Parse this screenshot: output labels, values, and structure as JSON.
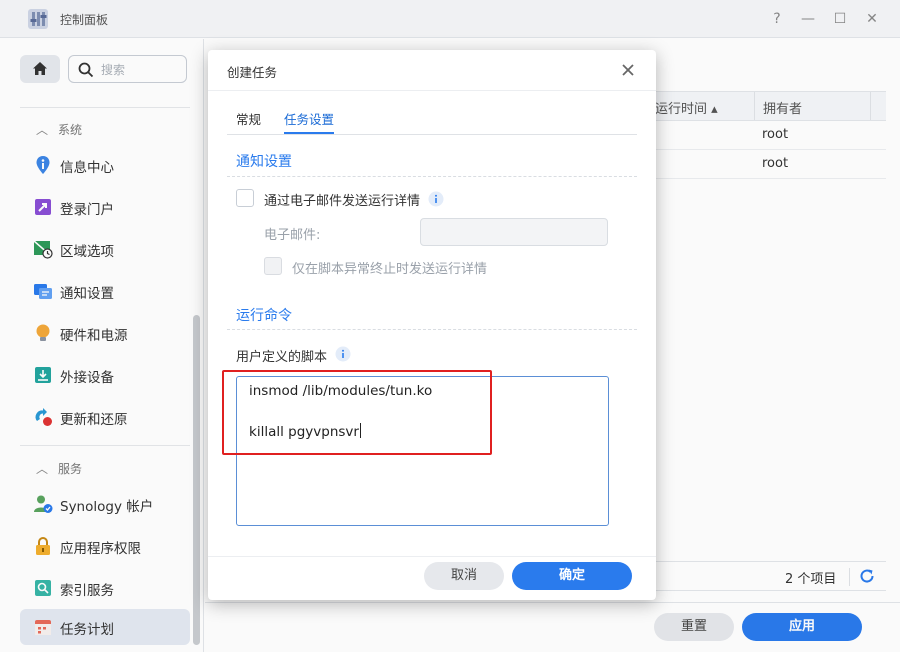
{
  "window": {
    "title": "控制面板",
    "controls": {
      "help": "?",
      "minimize": "—",
      "maximize": "☐",
      "close": "✕"
    }
  },
  "sidebar": {
    "search_placeholder": "搜索",
    "section_system": "系统",
    "section_services": "服务",
    "items": [
      {
        "label": "信息中心",
        "icon": "info-center-icon"
      },
      {
        "label": "登录门户",
        "icon": "login-portal-icon"
      },
      {
        "label": "区域选项",
        "icon": "regional-options-icon"
      },
      {
        "label": "通知设置",
        "icon": "notification-icon"
      },
      {
        "label": "硬件和电源",
        "icon": "hardware-power-icon"
      },
      {
        "label": "外接设备",
        "icon": "external-devices-icon"
      },
      {
        "label": "更新和还原",
        "icon": "update-restore-icon"
      },
      {
        "label": "Synology 帐户",
        "icon": "synology-account-icon"
      },
      {
        "label": "应用程序权限",
        "icon": "app-privileges-icon"
      },
      {
        "label": "索引服务",
        "icon": "indexing-service-icon"
      },
      {
        "label": "任务计划",
        "icon": "task-scheduler-icon",
        "active": true
      }
    ]
  },
  "table": {
    "col_run_time": "运行时间 ▴",
    "col_owner": "拥有者",
    "rows": [
      {
        "owner": "root"
      },
      {
        "owner": "root"
      }
    ],
    "count_text": "2 个项目"
  },
  "main_footer": {
    "reset_label": "重置",
    "apply_label": "应用"
  },
  "dialog": {
    "title": "创建任务",
    "tabs": [
      {
        "label": "常规",
        "active": false
      },
      {
        "label": "任务设置",
        "active": true
      }
    ],
    "notify_section": "通知设置",
    "email_checkbox_label": "通过电子邮件发送运行详情",
    "email_field_label": "电子邮件:",
    "email_value": "",
    "abnormal_checkbox_label": "仅在脚本异常终止时发送运行详情",
    "run_section": "运行命令",
    "script_label": "用户定义的脚本",
    "script_lines": [
      "insmod /lib/modules/tun.ko",
      "",
      "killall pgyvpnsvr"
    ],
    "cancel_label": "取消",
    "ok_label": "确定"
  },
  "colors": {
    "accent": "#2a7bed",
    "highlight_frame": "#e02020"
  }
}
